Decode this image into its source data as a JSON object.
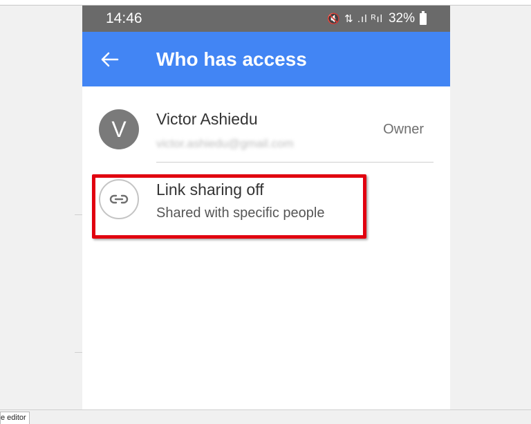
{
  "status_bar": {
    "time": "14:46",
    "icons": "🔇 ⇅ .ıl ᴿıl",
    "battery": "32%"
  },
  "app_bar": {
    "title": "Who has access",
    "back_icon": "arrow-back-icon"
  },
  "owner": {
    "avatar_letter": "V",
    "name": "Victor Ashiedu",
    "email": "victor.ashiedu@gmail.com",
    "role": "Owner"
  },
  "link_sharing": {
    "title": "Link sharing off",
    "subtitle": "Shared with specific people",
    "icon": "link-icon"
  },
  "colors": {
    "app_bar": "#4285f4",
    "status_bar": "#6a6a6a",
    "highlight": "#e1000f"
  },
  "bottom_tab": {
    "label": "e editor"
  }
}
